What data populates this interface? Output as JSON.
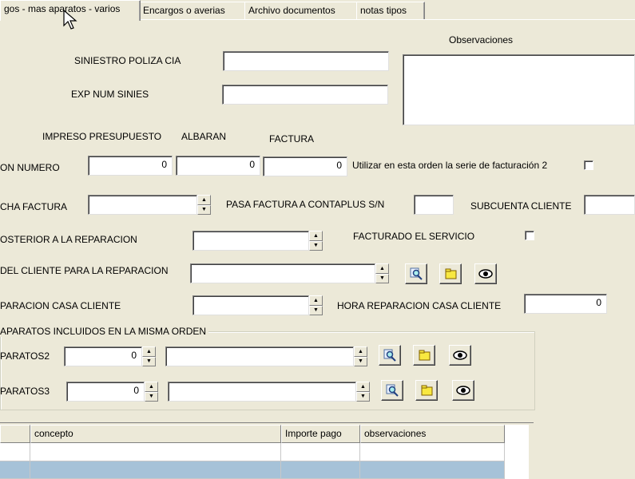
{
  "tabs": [
    {
      "label": "gos - mas aparatos - varios"
    },
    {
      "label": "Encargos o averias"
    },
    {
      "label": "Archivo documentos"
    },
    {
      "label": "notas tipos"
    }
  ],
  "labels": {
    "observaciones": "Observaciones",
    "siniestro": "SINIESTRO POLIZA CIA",
    "exp_num": "EXP NUM SINIES",
    "impreso": "IMPRESO PRESUPUESTO",
    "albaran": "ALBARAN",
    "factura": "FACTURA",
    "on_numero": "ON NUMERO",
    "serie2": "Utilizar en esta orden la serie de facturación 2",
    "cha_factura": "CHA FACTURA",
    "pasa_factura": "PASA FACTURA A CONTAPLUS S/N",
    "subcuenta": "SUBCUENTA CLIENTE",
    "posterior": "OSTERIOR A LA REPARACION",
    "facturado": "FACTURADO EL SERVICIO",
    "del_cliente": "DEL CLIENTE PARA LA REPARACION",
    "paracion_casa": "PARACION CASA CLIENTE",
    "hora_reparacion": "HORA  REPARACION CASA CLIENTE",
    "group_title": "APARATOS INCLUIDOS EN LA MISMA ORDEN",
    "aparatos2": "PARATOS2",
    "aparatos3": "PARATOS3"
  },
  "values": {
    "impreso": "0",
    "albaran": "0",
    "factura": "0",
    "hora_reparacion": "0",
    "aparatos2": "0",
    "aparatos3": "0"
  },
  "grid": {
    "columns": [
      "concepto",
      "Importe pago",
      "observaciones"
    ]
  },
  "icons": {
    "search": "search-icon",
    "folder": "folder-icon",
    "view": "eye-icon"
  }
}
